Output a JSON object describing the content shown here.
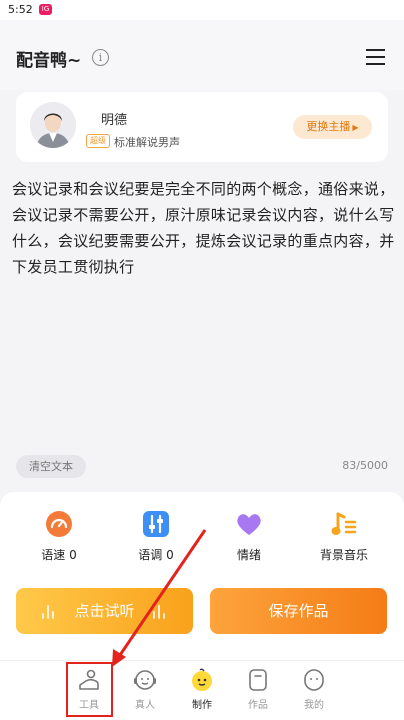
{
  "status_bar": {
    "time": "5:52",
    "badge": "IG"
  },
  "header": {
    "title": "配音鸭~",
    "info_icon": "info-icon",
    "menu_icon": "menu-icon"
  },
  "voice": {
    "name": "明德",
    "tag": "超级",
    "description": "标准解说男声",
    "change_label": "更换主播"
  },
  "editor": {
    "text": "会议记录和会议纪要是完全不同的两个概念，通俗来说，会议记录不需要公开，原汁原味记录会议内容，说什么写什么，会议纪要需要公开，提炼会议记录的重点内容，并下发员工贯彻执行",
    "clear_label": "清空文本",
    "char_count": "83/5000"
  },
  "tools": [
    {
      "label": "语速 0",
      "icon": "speed-gauge-icon"
    },
    {
      "label": "语调 0",
      "icon": "tone-slider-icon"
    },
    {
      "label": "情绪",
      "icon": "heart-icon"
    },
    {
      "label": "背景音乐",
      "icon": "music-note-icon"
    }
  ],
  "actions": {
    "preview_label": "点击试听",
    "save_label": "保存作品"
  },
  "tabs": [
    {
      "label": "工具",
      "icon": "tools-icon",
      "active": false
    },
    {
      "label": "真人",
      "icon": "headset-icon",
      "active": false
    },
    {
      "label": "制作",
      "icon": "duck-icon",
      "active": true
    },
    {
      "label": "作品",
      "icon": "works-icon",
      "active": false
    },
    {
      "label": "我的",
      "icon": "profile-icon",
      "active": false
    }
  ],
  "colors": {
    "accent": "#f9a11b",
    "annotation": "#e3231c"
  }
}
